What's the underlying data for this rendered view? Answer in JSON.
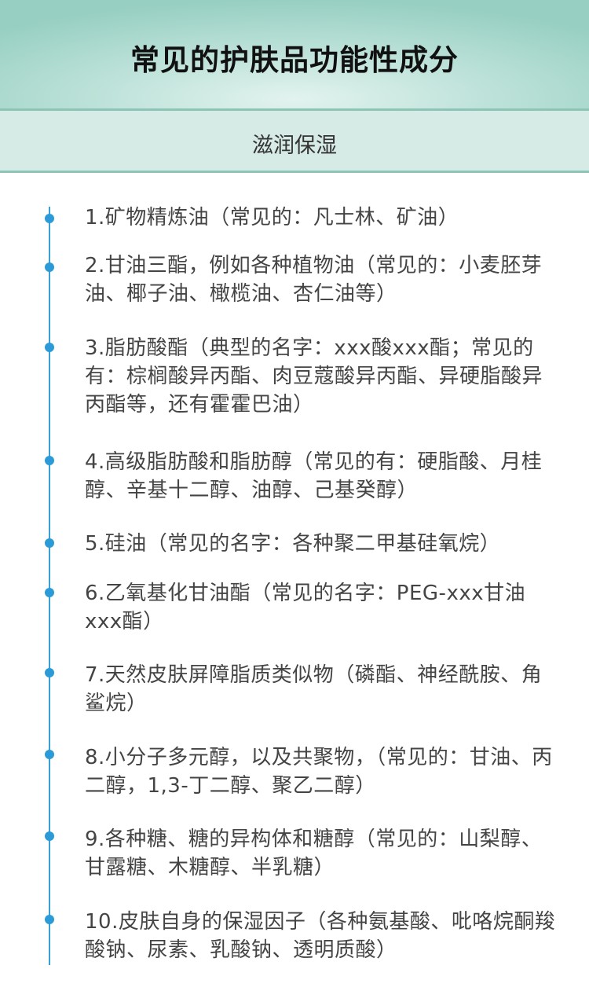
{
  "header": {
    "title": "常见的护肤品功能性成分"
  },
  "section": {
    "title": "滋润保湿"
  },
  "items": [
    "1.矿物精炼油（常见的：凡士林、矿油）",
    "2.甘油三酯，例如各种植物油（常见的：小麦胚芽油、椰子油、橄榄油、杏仁油等）",
    "3.脂肪酸酯（典型的名字：xxx酸xxx酯；常见的有：棕榈酸异丙酯、肉豆蔻酸异丙酯、异硬脂酸异丙酯等，还有霍霍巴油）",
    "4.高级脂肪酸和脂肪醇（常见的有：硬脂酸、月桂醇、辛基十二醇、油醇、己基癸醇）",
    "5.硅油（常见的名字：各种聚二甲基硅氧烷）",
    "6.乙氧基化甘油酯（常见的名字：PEG-xxx甘油xxx酯）",
    "7.天然皮肤屏障脂质类似物（磷酯、神经酰胺、角鲨烷）",
    "8.小分子多元醇，以及共聚物，（常见的：甘油、丙二醇，1,3-丁二醇、聚乙二醇）",
    "9.各种糖、糖的异构体和糖醇（常见的：山梨醇、甘露糖、木糖醇、半乳糖）",
    "10.皮肤自身的保湿因子（各种氨基酸、吡咯烷酮羧酸钠、尿素、乳酸钠、透明质酸）"
  ],
  "colors": {
    "header_bg": "#97cfc2",
    "subheader_bg": "#d7ebe6",
    "timeline": "#3aa1d8",
    "text": "#444444"
  }
}
